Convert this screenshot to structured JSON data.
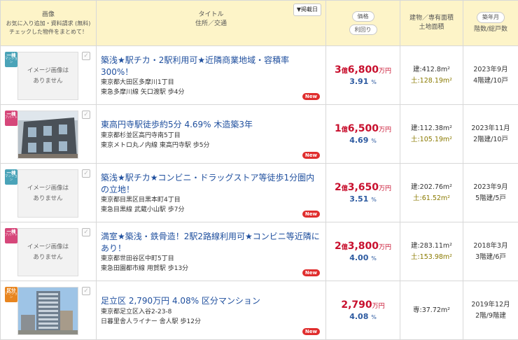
{
  "header": {
    "image_label": "画像",
    "image_note": "お気に入り追加・資料請求 (無料)\nチェックした物件をまとめて！",
    "title_label": "タイトル",
    "title_sub": "住所／交通",
    "sort_button": "▼掲載日",
    "price_button": "価格",
    "yield_button": "利回り",
    "area_label": "建物／専有面積",
    "area_sub": "土地面積",
    "age_button": "築年月",
    "floor_label": "階数/総戸数"
  },
  "colors": {
    "badge_house": "#4aa3b8",
    "badge_unit": "#e8851f",
    "price": "#c8102e",
    "yield": "#2d5aa0",
    "new": "#e02d2d"
  },
  "listings": [
    {
      "badge": "一棟",
      "badge_sub": "マンション",
      "badge_color": "#4aa3b8",
      "image_text": "イメージ画像は\nありません",
      "has_photo": false,
      "title": "築浅★駅チカ・2駅利用可★近隣商業地域・容積率300%！",
      "address": "東京都大田区多摩川1丁目",
      "access": "東急多摩川線 矢口渡駅 歩4分",
      "new": "New",
      "price_oku": "3",
      "price_oku_unit": "億",
      "price_man": "6,800",
      "price_unit": "万円",
      "yield_val": "3.91",
      "yield_unit": "%",
      "building": "建:412.8m²",
      "land": "土:128.19m²",
      "built": "2023年9月",
      "floors": "4階建/10戸"
    },
    {
      "badge": "一棟",
      "badge_sub": "アパート",
      "badge_color": "#d6477a",
      "image_text": "",
      "has_photo": true,
      "title": "東高円寺駅徒歩約5分 4.69% 木造築3年",
      "address": "東京都杉並区高円寺南5丁目",
      "access": "東京メトロ丸ノ内線 東高円寺駅 歩5分",
      "new": "New",
      "price_oku": "1",
      "price_oku_unit": "億",
      "price_man": "6,500",
      "price_unit": "万円",
      "yield_val": "4.69",
      "yield_unit": "%",
      "building": "建:112.38m²",
      "land": "土:105.19m²",
      "built": "2023年11月",
      "floors": "2階建/10戸"
    },
    {
      "badge": "一棟",
      "badge_sub": "マンション",
      "badge_color": "#4aa3b8",
      "image_text": "イメージ画像は\nありません",
      "has_photo": false,
      "title": "築浅★駅チカ★コンビニ・ドラッグストア等徒歩1分圏内の立地！",
      "address": "東京都目黒区目黒本町4丁目",
      "access": "東急目黒線 武蔵小山駅 歩7分",
      "new": "New",
      "price_oku": "2",
      "price_oku_unit": "億",
      "price_man": "3,650",
      "price_unit": "万円",
      "yield_val": "3.51",
      "yield_unit": "%",
      "building": "建:202.76m²",
      "land": "土:61.52m²",
      "built": "2023年9月",
      "floors": "5階建/5戸"
    },
    {
      "badge": "一棟",
      "badge_sub": "アパート",
      "badge_color": "#d6477a",
      "image_text": "イメージ画像は\nありません",
      "has_photo": false,
      "title": "満室★築浅・鉄骨造！2駅2路線利用可★コンビニ等近隣にあり！",
      "address": "東京都世田谷区中町5丁目",
      "access": "東急田園都市線 用賀駅 歩13分",
      "new": "New",
      "price_oku": "2",
      "price_oku_unit": "億",
      "price_man": "3,800",
      "price_unit": "万円",
      "yield_val": "4.00",
      "yield_unit": "%",
      "building": "建:283.11m²",
      "land": "土:153.98m²",
      "built": "2018年3月",
      "floors": "3階建/6戸"
    },
    {
      "badge": "区分",
      "badge_sub": "マンション",
      "badge_color": "#e8851f",
      "image_text": "",
      "has_photo": true,
      "title": "足立区 2,790万円 4.08% 区分マンション",
      "address": "東京都足立区入谷2-23-8",
      "access": "日暮里舎人ライナー 舎人駅 歩12分",
      "new": "New",
      "price_oku": "",
      "price_oku_unit": "",
      "price_man": "2,790",
      "price_unit": "万円",
      "yield_val": "4.08",
      "yield_unit": "%",
      "building": "専:37.72m²",
      "land": "",
      "built": "2019年12月",
      "floors": "2階/9階建"
    }
  ]
}
